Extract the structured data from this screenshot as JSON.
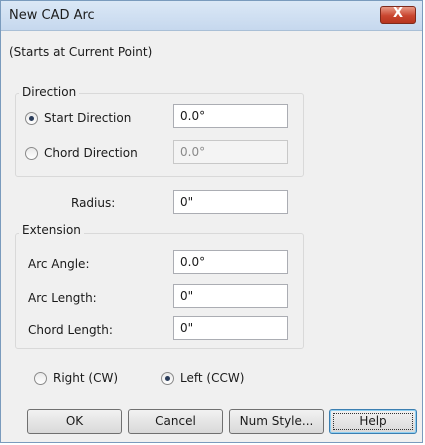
{
  "window": {
    "title": "New CAD Arc",
    "close_glyph": "X"
  },
  "subtitle": "(Starts at Current Point)",
  "direction": {
    "legend": "Direction",
    "start_direction": {
      "label": "Start Direction",
      "value": "0.0°",
      "selected": true
    },
    "chord_direction": {
      "label": "Chord Direction",
      "value": "0.0°",
      "selected": false
    }
  },
  "radius": {
    "label": "Radius:",
    "value": "0\""
  },
  "extension": {
    "legend": "Extension",
    "arc_angle": {
      "label": "Arc Angle:",
      "value": "0.0°"
    },
    "arc_length": {
      "label": "Arc Length:",
      "value": "0\""
    },
    "chord_length": {
      "label": "Chord Length:",
      "value": "0\""
    }
  },
  "orientation": {
    "right": {
      "label": "Right (CW)",
      "selected": false
    },
    "left": {
      "label": "Left (CCW)",
      "selected": true
    }
  },
  "buttons": {
    "ok": "OK",
    "cancel": "Cancel",
    "num_style": "Num Style...",
    "help": "Help"
  }
}
